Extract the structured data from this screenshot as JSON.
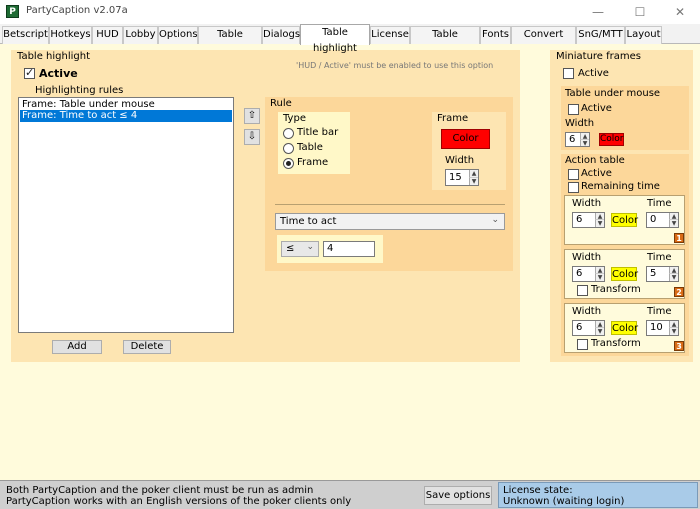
{
  "window": {
    "title": "PartyCaption v2.07a",
    "icon_letter": "P"
  },
  "tabs": [
    "Betscript",
    "Hotkeys",
    "HUD",
    "Lobby",
    "Options",
    "Table options",
    "Dialogs",
    "Table highlight",
    "License",
    "Table manager",
    "Fonts",
    "Convert chips",
    "SnG/MTT",
    "Layout"
  ],
  "table_highlight": {
    "title": "Table highlight",
    "active_label": "Active",
    "active_checked": true,
    "hint": "'HUD / Active' must be enabled to use this option",
    "rules_label": "Highlighting rules",
    "rules": [
      "Frame: Table under mouse",
      "Frame: Time to act ≤ 4"
    ],
    "selected_rule": 1,
    "add_label": "Add",
    "delete_label": "Delete",
    "rule": {
      "title": "Rule",
      "type_label": "Type",
      "types": [
        "Title bar",
        "Table",
        "Frame"
      ],
      "selected_type": 2,
      "frame_label": "Frame",
      "color_label": "Color",
      "color": "#ff0000",
      "width_label": "Width",
      "width": "15",
      "condition": "Time to act",
      "operator": "≤",
      "value": "4"
    }
  },
  "miniature": {
    "title": "Miniature frames",
    "active_label": "Active",
    "under_mouse": {
      "title": "Table under mouse",
      "active_label": "Active",
      "width_label": "Width",
      "width": "6",
      "color_label": "Color",
      "color": "#ff0000"
    },
    "action_table": {
      "title": "Action table",
      "active_label": "Active",
      "remaining_label": "Remaining time",
      "width_label": "Width",
      "time_label": "Time",
      "color_label": "Color",
      "transform_label": "Transform",
      "rows": [
        {
          "width": "6",
          "time": "0",
          "badge": "1"
        },
        {
          "width": "6",
          "time": "5",
          "badge": "2"
        },
        {
          "width": "6",
          "time": "10",
          "badge": "3"
        }
      ]
    }
  },
  "status": {
    "line1": "Both PartyCaption and the poker client must be run as admin",
    "line2": "PartyCaption works with an English versions of the poker clients only",
    "save_label": "Save options",
    "license_label": "License state:",
    "license_value": "Unknown (waiting login)"
  },
  "colors": {
    "panel": "#fde5b2",
    "inner": "#fcd79a",
    "background": "#fffbdc",
    "yellow": "#ffff00",
    "selection": "#0078d7"
  }
}
